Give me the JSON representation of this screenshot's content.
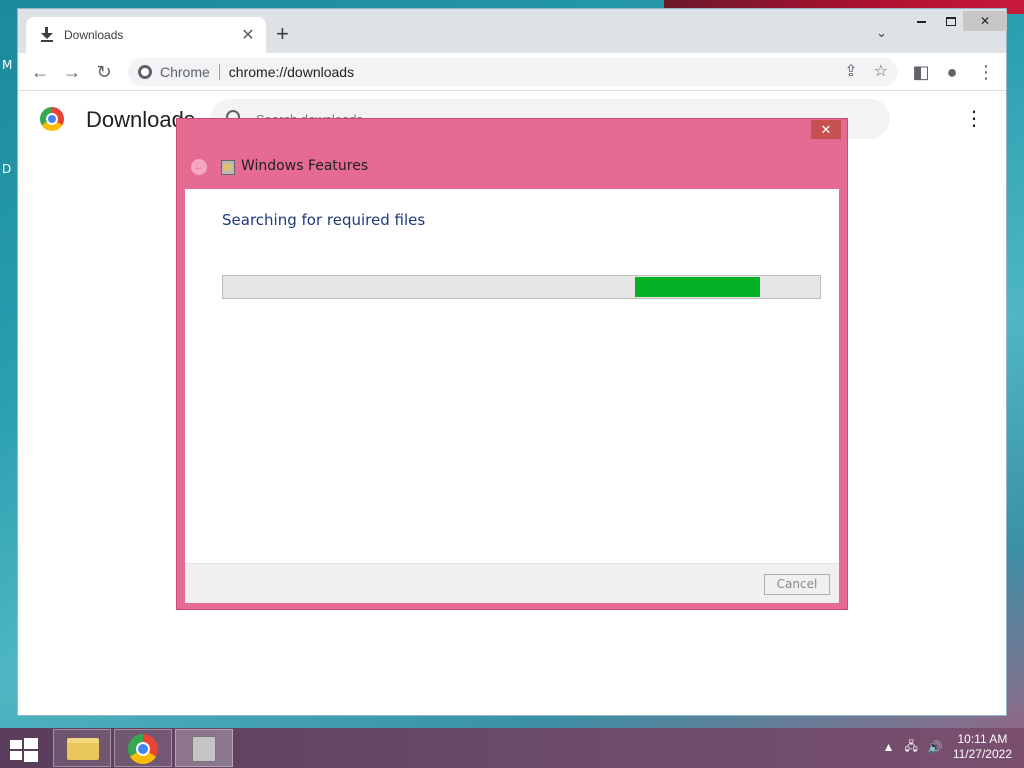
{
  "browser": {
    "tab": {
      "title": "Downloads",
      "close": "✕"
    },
    "new_tab": "+",
    "tab_list": "⌄",
    "window_controls": {
      "close": "✕"
    },
    "omnibox": {
      "chip": "Chrome",
      "url": "chrome://downloads"
    },
    "page": {
      "title": "Downloads",
      "search_placeholder": "Search downloads",
      "menu": "⋮"
    }
  },
  "dialog": {
    "window_close": "✕",
    "back": "←",
    "title": "Windows Features",
    "heading": "Searching for required files",
    "progress": {
      "start": 0.69,
      "end": 0.9,
      "color": "#06b025"
    },
    "cancel_label": "Cancel"
  },
  "taskbar": {
    "apps": [
      "file-explorer",
      "chrome",
      "windows-features"
    ],
    "tray": {
      "expand": "▲",
      "time": "10:11 AM",
      "date": "11/27/2022"
    }
  },
  "desktop": {
    "edge_labels": [
      "M",
      "D"
    ]
  },
  "colors": {
    "dialog_frame": "#e56b92",
    "heading": "#1e3a78",
    "progress_fill": "#06b025"
  }
}
